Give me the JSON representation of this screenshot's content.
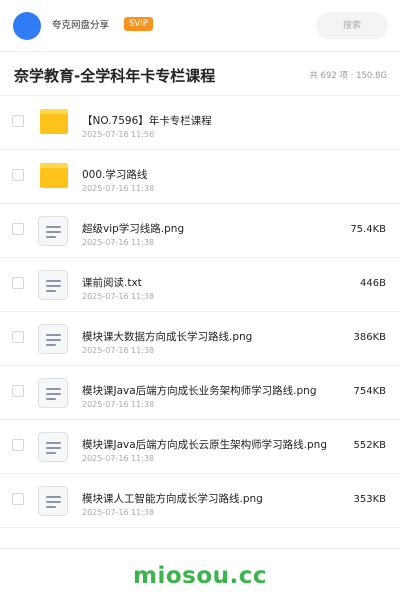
{
  "header": {
    "app_name": "夸克网盘分享",
    "badge": "SVIP",
    "search_placeholder": "搜索",
    "avatar_color": "#2f7cf6",
    "badge_color": "#f7931e"
  },
  "folder": {
    "title": "奈学教育-全学科年卡专栏课程",
    "count": "共 692 项",
    "separator": "·",
    "total_size": "150.8G"
  },
  "files": [
    {
      "type": "folder",
      "icon": "folder-icon",
      "name": "【NO.7596】年卡专栏课程",
      "date": "2025-07-16 11:56",
      "size": ""
    },
    {
      "type": "folder",
      "icon": "folder-icon",
      "name": "000.学习路线",
      "date": "2025-07-16 11:38",
      "size": ""
    },
    {
      "type": "file",
      "icon": "document-icon",
      "name": "超级vip学习线路.png",
      "date": "2025-07-16 11:38",
      "size": "75.4KB"
    },
    {
      "type": "file",
      "icon": "document-icon",
      "name": "课前阅读.txt",
      "date": "2025-07-16 11:38",
      "size": "446B"
    },
    {
      "type": "file",
      "icon": "document-icon",
      "name": "模块课大数据方向成长学习路线.png",
      "date": "2025-07-16 11:38",
      "size": "386KB"
    },
    {
      "type": "file",
      "icon": "document-icon",
      "name": "模块课Java后端方向成长业务架构师学习路线.png",
      "date": "2025-07-16 11:38",
      "size": "754KB"
    },
    {
      "type": "file",
      "icon": "document-icon",
      "name": "模块课Java后端方向成长云原生架构师学习路线.png",
      "date": "2025-07-16 11:38",
      "size": "552KB"
    },
    {
      "type": "file",
      "icon": "document-icon",
      "name": "模块课人工智能方向成长学习路线.png",
      "date": "2025-07-16 11:38",
      "size": "353KB"
    }
  ],
  "footer": {
    "watermark": "miosou.cc",
    "watermark_color": "#3ab54a"
  }
}
